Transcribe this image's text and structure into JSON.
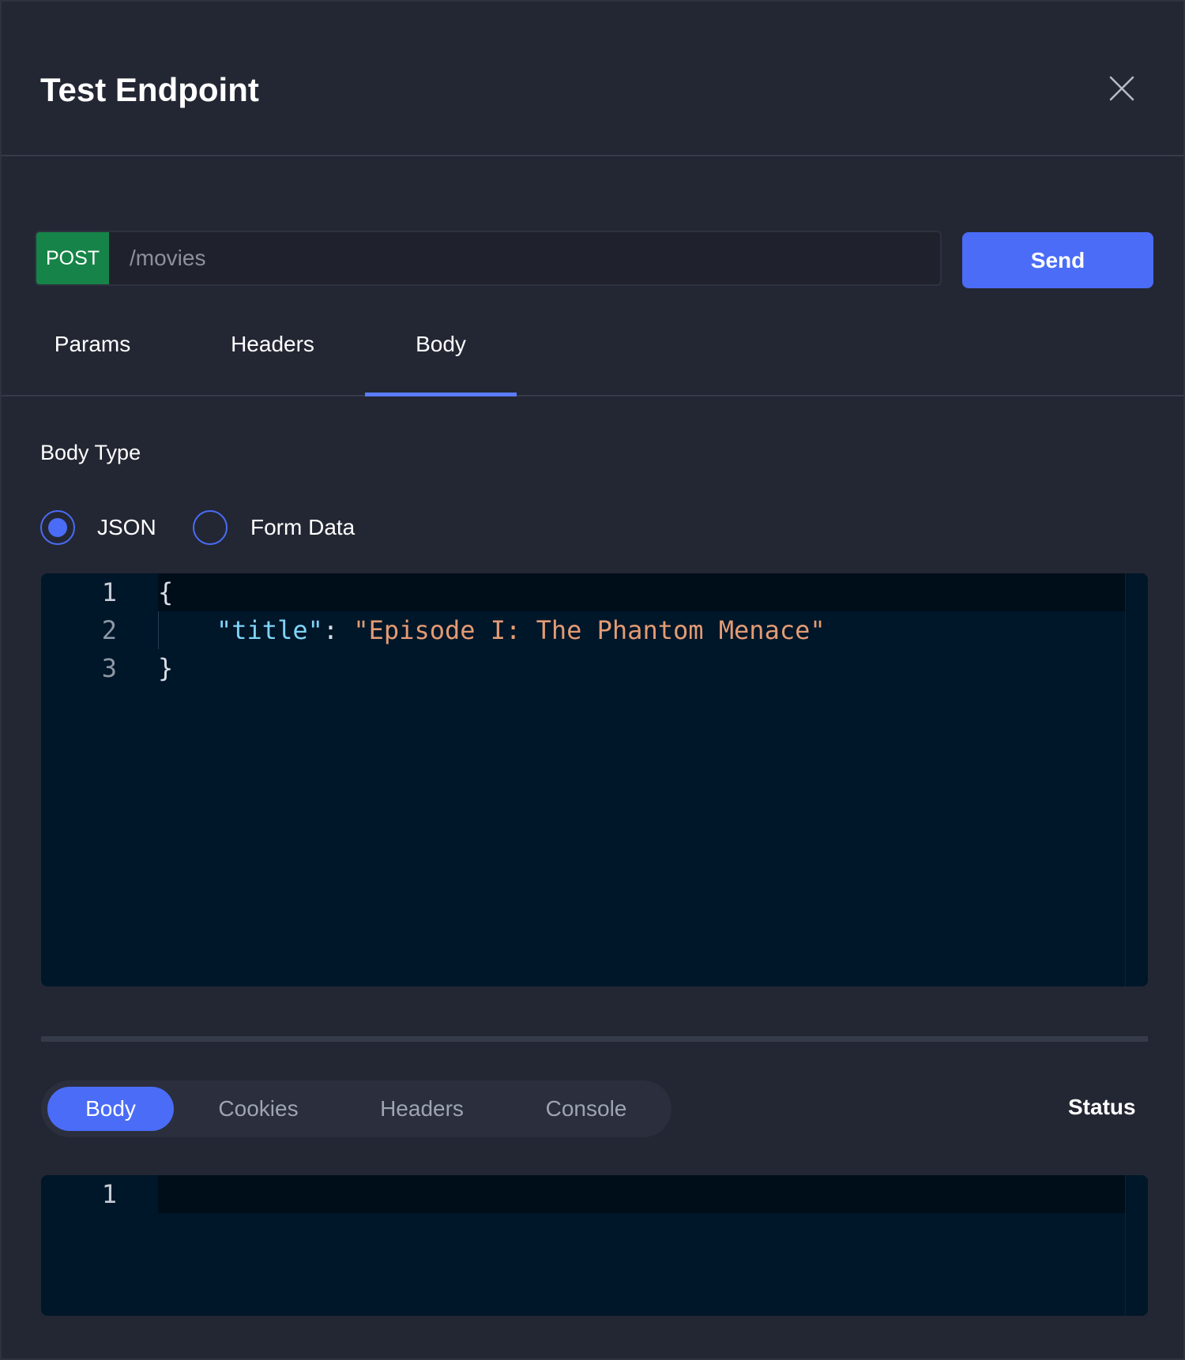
{
  "dialog": {
    "title": "Test Endpoint",
    "close_icon": "close-icon"
  },
  "request": {
    "method": "POST",
    "method_color": "#168448",
    "path": "/movies",
    "send_label": "Send",
    "accent_color": "#4a6cf7"
  },
  "request_tabs": [
    {
      "label": "Params",
      "active": false
    },
    {
      "label": "Headers",
      "active": false
    },
    {
      "label": "Body",
      "active": true
    }
  ],
  "body_type": {
    "label": "Body Type",
    "options": [
      {
        "label": "JSON",
        "selected": true
      },
      {
        "label": "Form Data",
        "selected": false
      }
    ]
  },
  "request_editor": {
    "lines": [
      {
        "number": "1",
        "open": "{"
      },
      {
        "number": "2",
        "key": "\"title\"",
        "sep": ": ",
        "value": "\"Episode I: The Phantom Menace\""
      },
      {
        "number": "3",
        "close": "}"
      }
    ]
  },
  "response_tabs": [
    {
      "label": "Body",
      "active": true
    },
    {
      "label": "Cookies",
      "active": false
    },
    {
      "label": "Headers",
      "active": false
    },
    {
      "label": "Console",
      "active": false
    }
  ],
  "response": {
    "status_label": "Status",
    "editor_lines": [
      {
        "number": "1"
      }
    ]
  }
}
